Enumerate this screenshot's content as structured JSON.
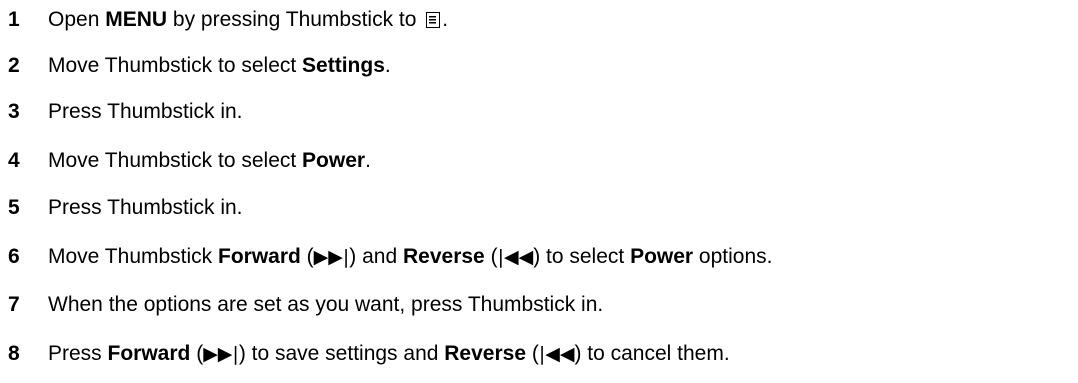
{
  "steps": [
    {
      "number": "1",
      "segments": [
        {
          "text": "Open ",
          "style": "normal"
        },
        {
          "text": "MENU",
          "style": "bold"
        },
        {
          "text": " by pressing Thumbstick to ",
          "style": "normal"
        },
        {
          "icon": "menu-list-icon"
        },
        {
          "text": ".",
          "style": "normal"
        }
      ]
    },
    {
      "number": "2",
      "segments": [
        {
          "text": "Move Thumbstick to select ",
          "style": "normal"
        },
        {
          "text": "Settings",
          "style": "bold"
        },
        {
          "text": ".",
          "style": "normal"
        }
      ]
    },
    {
      "number": "3",
      "segments": [
        {
          "text": "Press Thumbstick in.",
          "style": "normal"
        }
      ]
    },
    {
      "number": "4",
      "segments": [
        {
          "text": "Move Thumbstick to select ",
          "style": "normal"
        },
        {
          "text": "Power",
          "style": "bold"
        },
        {
          "text": ".",
          "style": "normal"
        }
      ]
    },
    {
      "number": "5",
      "segments": [
        {
          "text": "Press Thumbstick in.",
          "style": "normal"
        }
      ]
    },
    {
      "number": "6",
      "segments": [
        {
          "text": "Move Thumbstick ",
          "style": "normal"
        },
        {
          "text": "Forward",
          "style": "bold"
        },
        {
          "text": " (",
          "style": "normal"
        },
        {
          "text": "▶▶|",
          "style": "icon"
        },
        {
          "text": ") and ",
          "style": "normal"
        },
        {
          "text": "Reverse",
          "style": "bold"
        },
        {
          "text": " (",
          "style": "normal"
        },
        {
          "text": "|◀◀",
          "style": "icon"
        },
        {
          "text": ") to select ",
          "style": "normal"
        },
        {
          "text": "Power",
          "style": "bold"
        },
        {
          "text": " options.",
          "style": "normal"
        }
      ]
    },
    {
      "number": "7",
      "segments": [
        {
          "text": "When the options are set as you want, press Thumbstick in.",
          "style": "normal"
        }
      ]
    },
    {
      "number": "8",
      "segments": [
        {
          "text": "Press ",
          "style": "normal"
        },
        {
          "text": "Forward",
          "style": "bold"
        },
        {
          "text": " (",
          "style": "normal"
        },
        {
          "text": "▶▶|",
          "style": "icon"
        },
        {
          "text": ") to save settings and ",
          "style": "normal"
        },
        {
          "text": "Reverse",
          "style": "bold"
        },
        {
          "text": " (",
          "style": "normal"
        },
        {
          "text": "|◀◀",
          "style": "icon"
        },
        {
          "text": ") to cancel them.",
          "style": "normal"
        }
      ]
    }
  ]
}
